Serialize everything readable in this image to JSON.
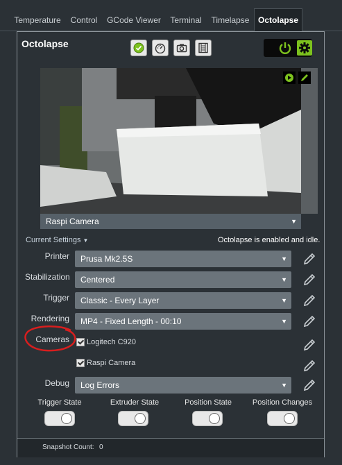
{
  "tabs": [
    "Temperature",
    "Control",
    "GCode Viewer",
    "Terminal",
    "Timelapse",
    "Octolapse"
  ],
  "active_tab": "Octolapse",
  "panel": {
    "title": "Octolapse"
  },
  "camera": {
    "selected": "Raspi Camera"
  },
  "settings": {
    "current_settings_label": "Current Settings",
    "status_text": "Octolapse is enabled and idle.",
    "rows": [
      {
        "label": "Printer",
        "value": "Prusa Mk2.5S"
      },
      {
        "label": "Stabilization",
        "value": "Centered"
      },
      {
        "label": "Trigger",
        "value": "Classic - Every Layer"
      },
      {
        "label": "Rendering",
        "value": "MP4 - Fixed Length - 00:10"
      }
    ],
    "cameras_label": "Cameras",
    "cameras": [
      "Logitech C920",
      "Raspi Camera"
    ],
    "debug_label": "Debug",
    "debug_value": "Log Errors"
  },
  "states": [
    "Trigger State",
    "Extruder State",
    "Position State",
    "Position Changes"
  ],
  "footer": {
    "snapshot_label": "Snapshot Count:",
    "snapshot_count": "0"
  },
  "colors": {
    "accent_green": "#7dc21e",
    "annotation_red": "#d81e1e"
  }
}
